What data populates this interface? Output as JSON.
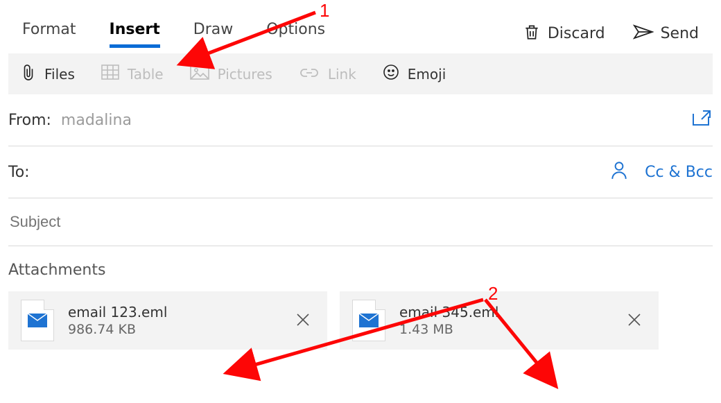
{
  "tabs": {
    "items": [
      "Format",
      "Insert",
      "Draw",
      "Options"
    ],
    "active_index": 1
  },
  "actions": {
    "discard": "Discard",
    "send": "Send"
  },
  "toolbar": {
    "files": "Files",
    "table": "Table",
    "pictures": "Pictures",
    "link": "Link",
    "emoji": "Emoji"
  },
  "compose": {
    "from_label": "From:",
    "from_value": "madalina",
    "to_label": "To:",
    "cc_bcc": "Cc & Bcc",
    "subject_placeholder": "Subject",
    "attachments_label": "Attachments"
  },
  "attachments": [
    {
      "name": "email 123.eml",
      "size": "986.74 KB"
    },
    {
      "name": "email 345.eml",
      "size": "1.43 MB"
    }
  ],
  "annotations": {
    "a1": "1",
    "a2": "2"
  },
  "colors": {
    "accent": "#0a6cd6",
    "annotation": "#fd0606",
    "panel_bg": "#f3f3f3"
  }
}
